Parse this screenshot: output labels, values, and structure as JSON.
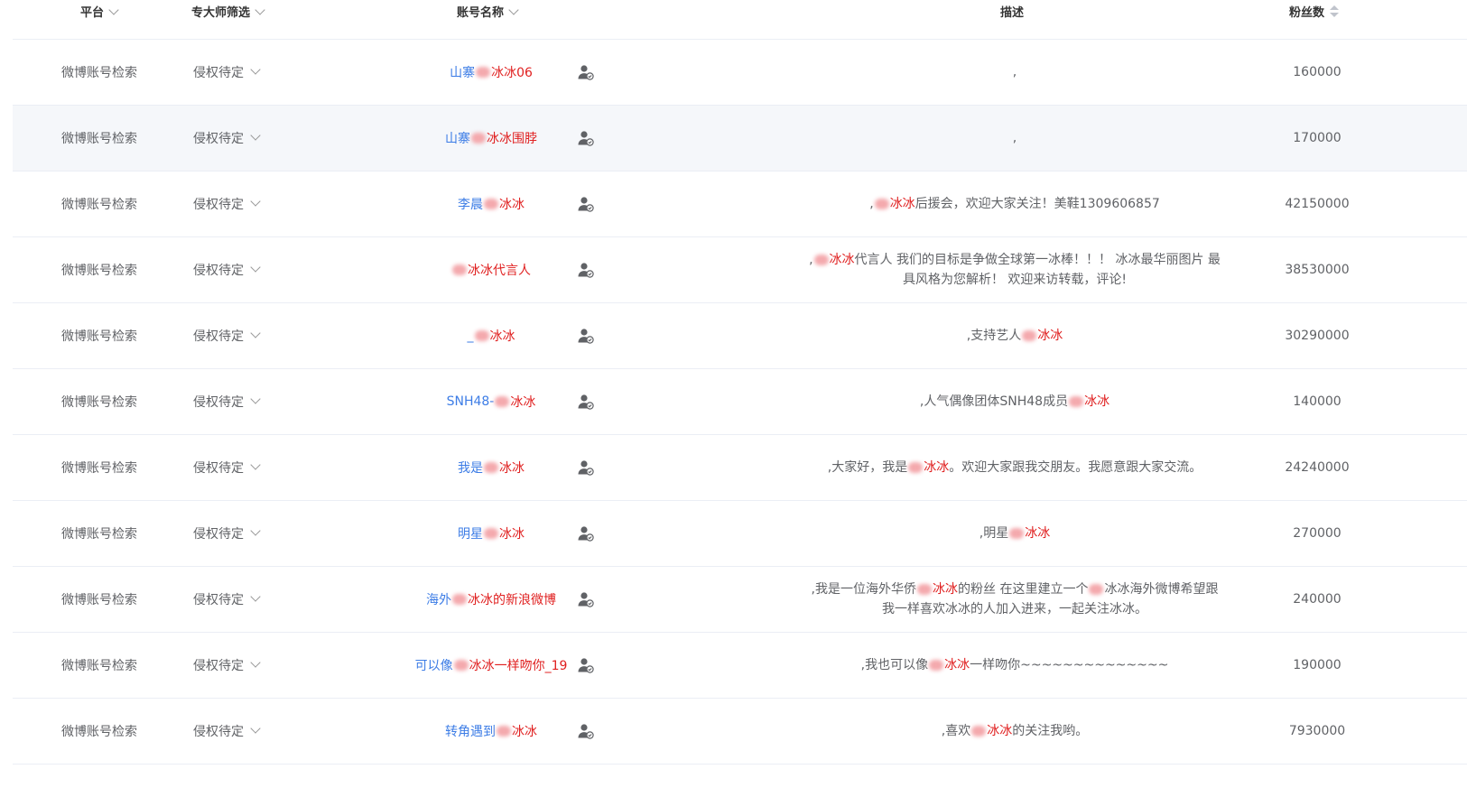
{
  "headers": {
    "platform": "平台",
    "filter": "专大师筛选",
    "name": "账号名称",
    "desc": "描述",
    "fans": "粉丝数"
  },
  "icons": {
    "filter_dropdown": "chevron-down-icon",
    "account": "user-check-icon",
    "sort": "sort-icon"
  },
  "colors": {
    "link": "#3d7de6",
    "highlight": "#e02020",
    "stripe": "#f5f7fa"
  },
  "rows": [
    {
      "platform": "微博账号检索",
      "filter": "侵权待定",
      "name_a": "山寨",
      "name_b": "冰冰06",
      "desc_a": ",",
      "desc_hl": "",
      "desc_b": "",
      "desc_c": "",
      "fans": "160000"
    },
    {
      "platform": "微博账号检索",
      "filter": "侵权待定",
      "name_a": "山寨",
      "name_b": "冰冰围脖",
      "desc_a": ",",
      "desc_hl": "",
      "desc_b": "",
      "desc_c": "",
      "fans": "170000"
    },
    {
      "platform": "微博账号检索",
      "filter": "侵权待定",
      "name_a": "李晨",
      "name_b": "冰冰",
      "desc_a": ",",
      "desc_hl": "冰冰",
      "desc_b": "后援会，欢迎大家关注！美鞋1309606857",
      "desc_c": "",
      "fans": "42150000"
    },
    {
      "platform": "微博账号检索",
      "filter": "侵权待定",
      "name_a": "",
      "name_b": "冰冰代言人",
      "desc_a": ",",
      "desc_hl": "冰冰",
      "desc_b": "代言人 我们的目标是争做全球第一冰棒！！！ 冰冰最华丽图片 最具风格为您解析！ 欢迎来访转载，评论!",
      "desc_c": "",
      "fans": "38530000"
    },
    {
      "platform": "微博账号检索",
      "filter": "侵权待定",
      "name_a": "_",
      "name_b": "冰冰",
      "desc_a": ",支持艺人",
      "desc_hl": "冰冰",
      "desc_b": "",
      "desc_c": "",
      "fans": "30290000"
    },
    {
      "platform": "微博账号检索",
      "filter": "侵权待定",
      "name_a": "SNH48-",
      "name_b": "冰冰",
      "desc_a": ",人气偶像团体SNH48成员",
      "desc_hl": "冰冰",
      "desc_b": "",
      "desc_c": "",
      "fans": "140000"
    },
    {
      "platform": "微博账号检索",
      "filter": "侵权待定",
      "name_a": "我是",
      "name_b": "冰冰",
      "desc_a": ",大家好，我是",
      "desc_hl": "冰冰",
      "desc_b": "。欢迎大家跟我交朋友。我愿意跟大家交流。",
      "desc_c": "",
      "fans": "24240000"
    },
    {
      "platform": "微博账号检索",
      "filter": "侵权待定",
      "name_a": "明星",
      "name_b": "冰冰",
      "desc_a": ",明星",
      "desc_hl": "冰冰",
      "desc_b": "",
      "desc_c": "",
      "fans": "270000"
    },
    {
      "platform": "微博账号检索",
      "filter": "侵权待定",
      "name_a": "海外",
      "name_b": "冰冰的新浪微博",
      "desc_a": ",我是一位海外华侨",
      "desc_hl": "冰冰",
      "desc_b": "的粉丝 在这里建立一个",
      "desc_c": "冰冰海外微博希望跟我一样喜欢冰冰的人加入进来，一起关注冰冰。",
      "fans": "240000"
    },
    {
      "platform": "微博账号检索",
      "filter": "侵权待定",
      "name_a": "可以像",
      "name_b": "冰冰一样吻你_19",
      "desc_a": ",我也可以像",
      "desc_hl": "冰冰",
      "desc_b": "一样吻你~~~~~~~~~~~~~~",
      "desc_c": "",
      "fans": "190000"
    },
    {
      "platform": "微博账号检索",
      "filter": "侵权待定",
      "name_a": "转角遇到",
      "name_b": "冰冰",
      "desc_a": ",喜欢",
      "desc_hl": "冰冰",
      "desc_b": "的关注我哟。",
      "desc_c": "",
      "fans": "7930000"
    }
  ]
}
